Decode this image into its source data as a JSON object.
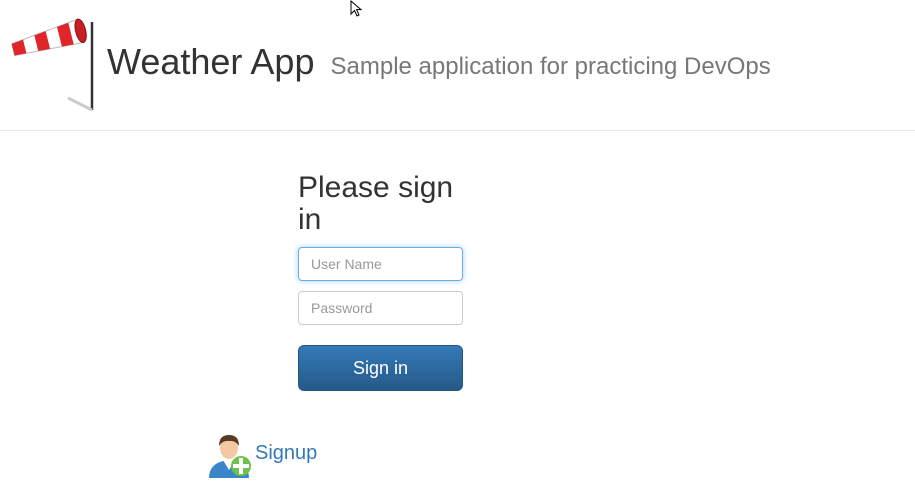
{
  "header": {
    "title": "Weather App",
    "subtitle": "Sample application for practicing DevOps",
    "logo_icon": "windsock-icon"
  },
  "login": {
    "heading": "Please sign in",
    "username_placeholder": "User Name",
    "password_placeholder": "Password",
    "signin_label": "Sign in"
  },
  "signup": {
    "label": "Signup",
    "icon": "add-user-icon"
  },
  "colors": {
    "primary": "#337ab7",
    "focus_border": "#66afe9",
    "windsock_red": "#e0262b"
  }
}
